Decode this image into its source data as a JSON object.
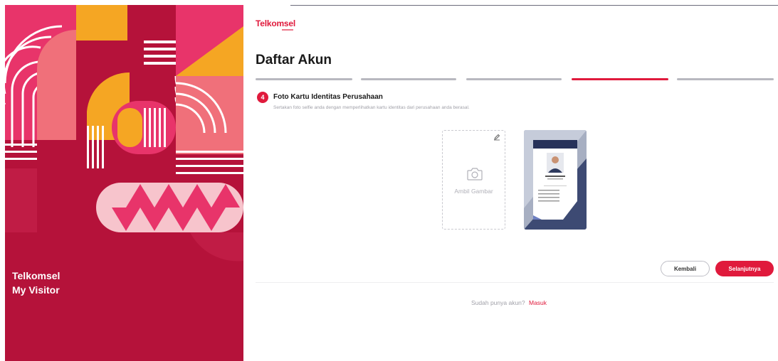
{
  "brand": {
    "line1": "Telkomsel",
    "line2": "My Visitor",
    "logo": "Telkomsel"
  },
  "page": {
    "title": "Daftar Akun"
  },
  "steps": {
    "total": 5,
    "current": 4
  },
  "current_step": {
    "number": "4",
    "title": "Foto Kartu Identitas Perusahaan",
    "description": "Sertakan foto selfie anda dengan memperlihatkan kartu identitas dari perusahaan anda berasal."
  },
  "upload": {
    "label": "Ambil Gambar",
    "icon": "camera-icon",
    "edit_icon": "edit-icon"
  },
  "buttons": {
    "back": "Kembali",
    "next": "Selanjutnya"
  },
  "footer": {
    "question": "Sudah punya akun?",
    "login_link": "Masuk"
  },
  "colors": {
    "accent": "#e01a3c",
    "panel": "#b5123a"
  }
}
